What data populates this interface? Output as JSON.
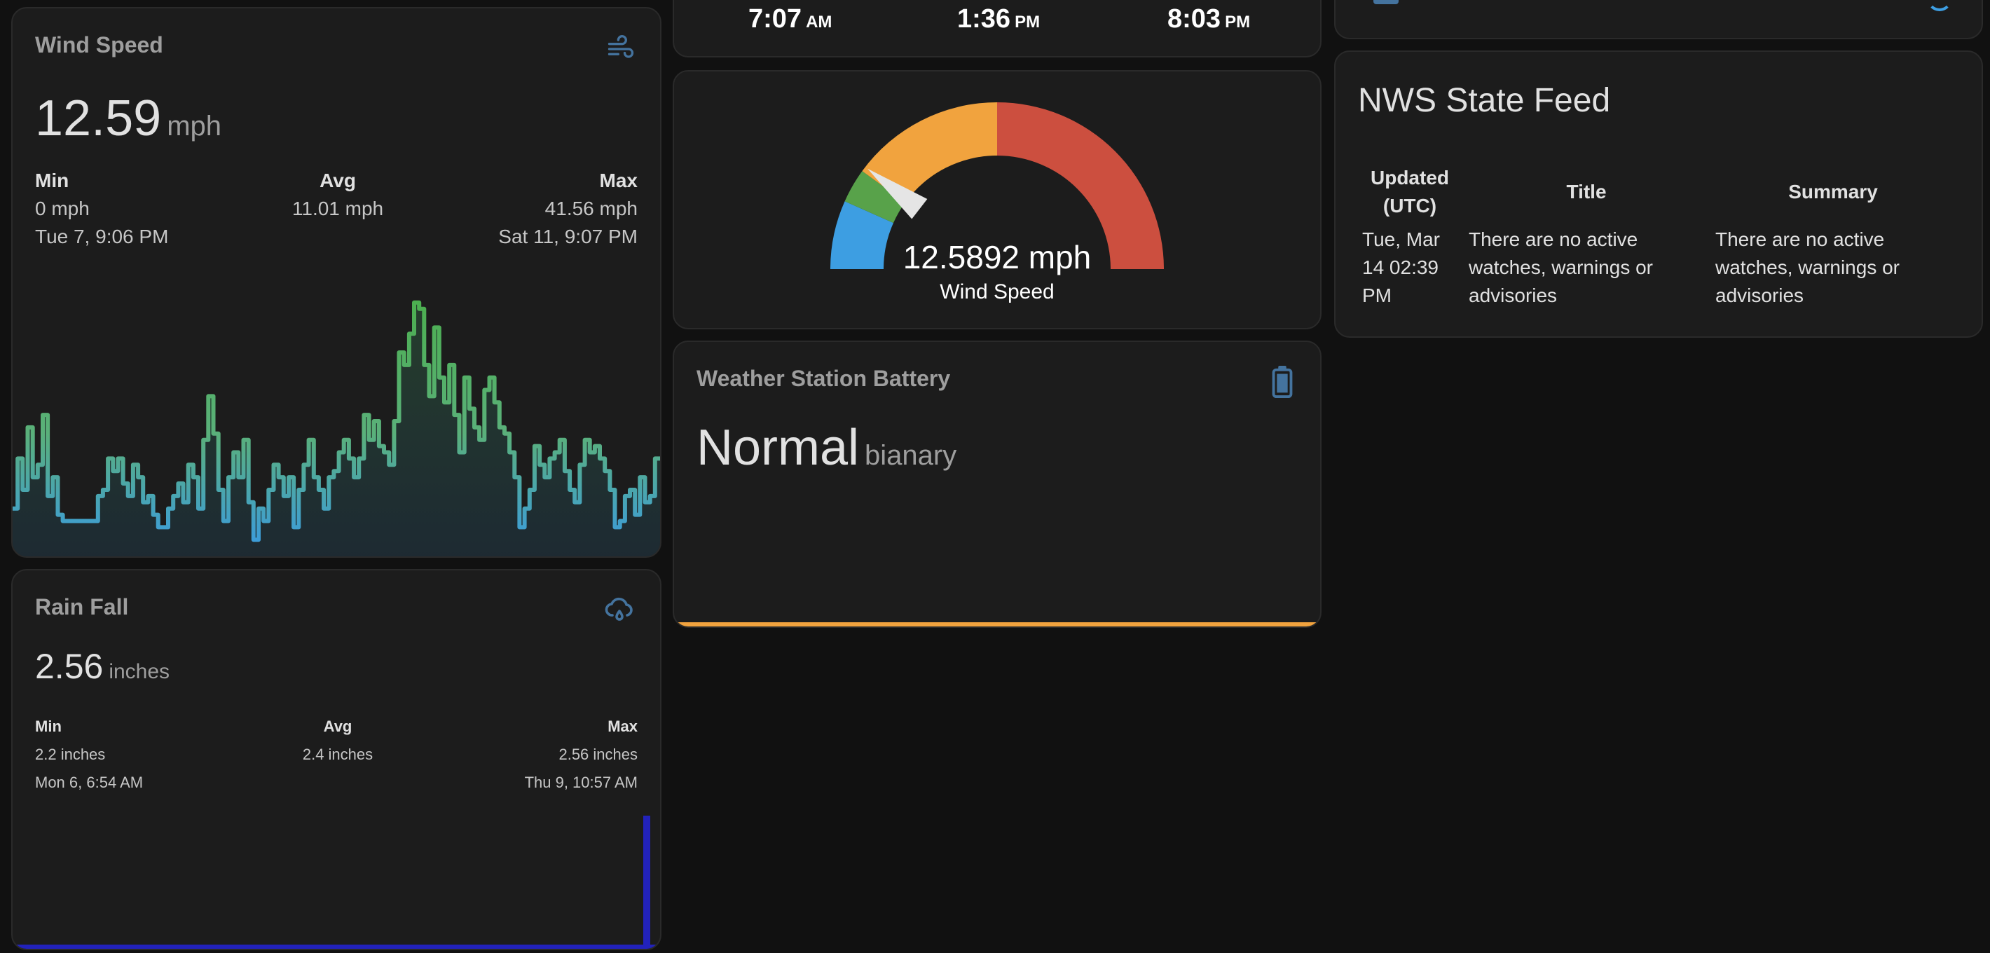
{
  "wind_card": {
    "title": "Wind Speed",
    "icon": "weather-windy-icon",
    "value": "12.59",
    "unit": "mph",
    "min_label": "Min",
    "min_value": "0 mph",
    "min_time": "Tue 7, 9:06 PM",
    "avg_label": "Avg",
    "avg_value": "11.01 mph",
    "max_label": "Max",
    "max_value": "41.56 mph",
    "max_time": "Sat 11, 9:07 PM",
    "graph": {
      "color_low": "#3d9dd8",
      "color_high": "#4caf50",
      "values": [
        7,
        15,
        10,
        20,
        12,
        14,
        22,
        9,
        12,
        6,
        5,
        5,
        5,
        5,
        5,
        5,
        5,
        9,
        10,
        15,
        13,
        15,
        11,
        9,
        14,
        12,
        8,
        9,
        6,
        4,
        4,
        7,
        9,
        11,
        8,
        14,
        12,
        7,
        18,
        25,
        19,
        10,
        5,
        12,
        16,
        12,
        18,
        8,
        2,
        7,
        5,
        10,
        14,
        12,
        9,
        12,
        4,
        10,
        14,
        18,
        12,
        10,
        7,
        12,
        13,
        16,
        18,
        15,
        12,
        15,
        22,
        18,
        21,
        17,
        16,
        14,
        21,
        32,
        30,
        35,
        40,
        39,
        30,
        25,
        36,
        28,
        24,
        30,
        22,
        16,
        28,
        23,
        20,
        18,
        26,
        28,
        24,
        20,
        19,
        16,
        12,
        4,
        7,
        10,
        17,
        14,
        12,
        15,
        16,
        18,
        13,
        10,
        8,
        14,
        18,
        16,
        17,
        15,
        13,
        10,
        4,
        5,
        9,
        10,
        6,
        12,
        8,
        9,
        15
      ]
    }
  },
  "rain_card": {
    "title": "Rain Fall",
    "icon": "weather-pouring-icon",
    "value": "2.56",
    "unit": "inches",
    "min_label": "Min",
    "min_value": "2.2 inches",
    "min_time": "Mon 6, 6:54 AM",
    "avg_label": "Avg",
    "avg_value": "2.4 inches",
    "max_label": "Max",
    "max_value": "2.56 inches",
    "max_time": "Thu 9, 10:57 AM",
    "bar_color": "#2222bb"
  },
  "sun_card": {
    "sunrise": "7:07",
    "sunrise_period": "AM",
    "noon": "1:36",
    "noon_period": "PM",
    "sunset": "8:03",
    "sunset_period": "PM"
  },
  "gauge_card": {
    "value": 12.5892,
    "display_value": "12.5892 mph",
    "name": "Wind Speed",
    "max": 60,
    "segments": [
      {
        "from": 0,
        "to": 8,
        "color": "#3d9ee2"
      },
      {
        "from": 8,
        "to": 12,
        "color": "#58a24a"
      },
      {
        "from": 12,
        "to": 30,
        "color": "#f1a33e"
      },
      {
        "from": 30,
        "to": 60,
        "color": "#cc4f3f"
      }
    ],
    "needle_color": "#e5e5e5"
  },
  "battery_card": {
    "title": "Weather Station Battery",
    "icon": "battery-icon",
    "value": "Normal",
    "unit": "bianary",
    "accent_color": "#f1a33e"
  },
  "nws_card": {
    "title": "NWS State Feed",
    "columns": [
      "Updated (UTC)",
      "Title",
      "Summary"
    ],
    "rows": [
      [
        "Tue, Mar 14 02:39 PM",
        "There are no active watches, warnings or advisories",
        "There are no active watches, warnings or advisories"
      ]
    ]
  },
  "top_right_card": {
    "icon_left": "calendar-icon",
    "icon_right": "info-icon"
  }
}
